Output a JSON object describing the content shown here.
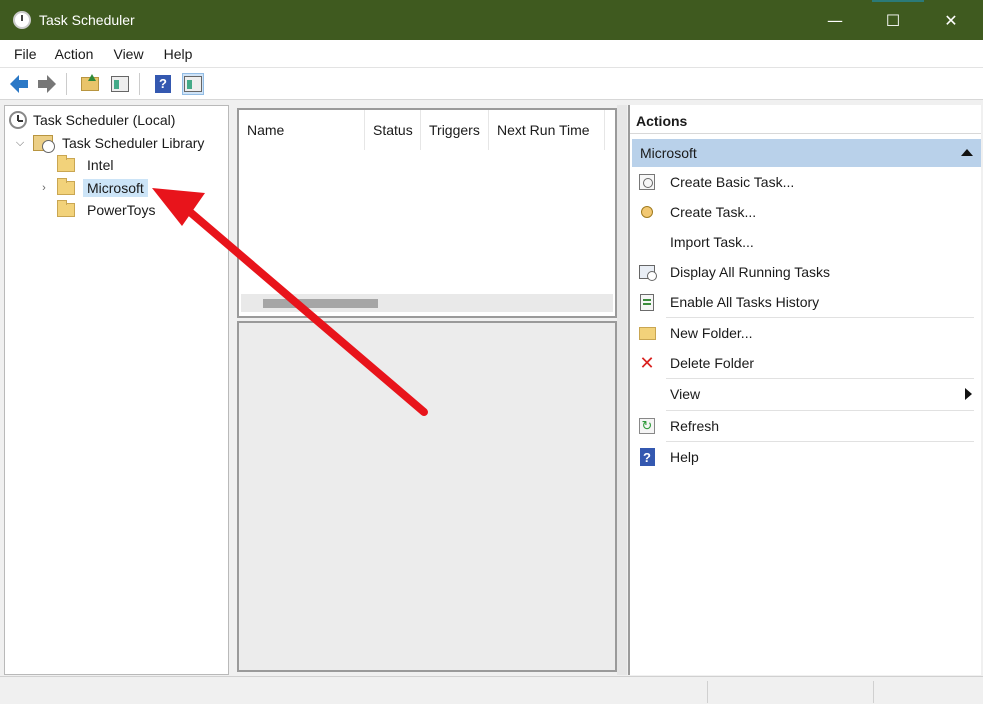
{
  "window": {
    "title": "Task Scheduler",
    "icon": "clock-icon"
  },
  "menu": [
    {
      "label": "File"
    },
    {
      "label": "Action"
    },
    {
      "label": "View"
    },
    {
      "label": "Help"
    }
  ],
  "toolbar": {
    "icons": [
      "back-icon",
      "forward-icon",
      "folder-up-icon",
      "show-hide-console-tree-icon",
      "help-icon",
      "show-hide-action-pane-icon"
    ]
  },
  "tree": {
    "root": "Task Scheduler (Local)",
    "library": "Task Scheduler Library",
    "folders": [
      "Intel",
      "Microsoft",
      "PowerToys"
    ],
    "selected": "Microsoft"
  },
  "task_list": {
    "columns": [
      "Name",
      "Status",
      "Triggers",
      "Next Run Time"
    ]
  },
  "actions": {
    "header": "Actions",
    "section": "Microsoft",
    "items": [
      {
        "label": "Create Basic Task...",
        "icon": "create-basic-task-icon"
      },
      {
        "label": "Create Task...",
        "icon": "create-task-icon"
      },
      {
        "label": "Import Task...",
        "icon": ""
      },
      {
        "label": "Display All Running Tasks",
        "icon": "display-running-tasks-icon"
      },
      {
        "label": "Enable All Tasks History",
        "icon": "tasks-history-icon"
      },
      {
        "label": "New Folder...",
        "icon": "new-folder-icon"
      },
      {
        "label": "Delete Folder",
        "icon": "delete-icon"
      },
      {
        "label": "View",
        "icon": ""
      },
      {
        "label": "Refresh",
        "icon": "refresh-icon"
      },
      {
        "label": "Help",
        "icon": "help-icon"
      }
    ]
  },
  "colors": {
    "titlebar": "#3f5a1f",
    "selection": "#cce4f7",
    "actions_section": "#b9d1ea",
    "annotation_arrow": "#e8141b"
  }
}
